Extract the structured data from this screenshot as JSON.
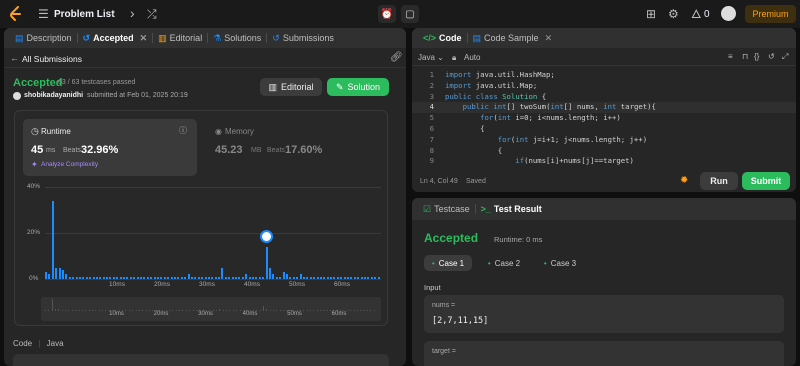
{
  "topbar": {
    "title": "Problem List",
    "streak": "0",
    "premium": "Premium"
  },
  "left": {
    "tabs": [
      {
        "label": "Description"
      },
      {
        "label": "Accepted"
      },
      {
        "label": "Editorial"
      },
      {
        "label": "Solutions"
      },
      {
        "label": "Submissions"
      }
    ],
    "back": "All Submissions",
    "status": "Accepted",
    "testcases": "63 / 63 testcases passed",
    "user": "shobikadayanidhi",
    "submitted": "submitted at Feb 01, 2025 20:19",
    "editorial_btn": "Editorial",
    "solution_btn": "Solution",
    "runtime": {
      "title": "Runtime",
      "value": "45",
      "unit": "ms",
      "beats_label": "Beats",
      "beats": "32.96%",
      "analyze": "Analyze Complexity"
    },
    "memory": {
      "title": "Memory",
      "value": "45.23",
      "unit": "MB",
      "beats_label": "Beats",
      "beats": "17.60%"
    },
    "chart": {
      "yticks": [
        "40%",
        "20%",
        "0%"
      ],
      "xticks": [
        "10ms",
        "20ms",
        "30ms",
        "40ms",
        "50ms",
        "60ms"
      ],
      "mini_ticks": [
        "10ms",
        "20ms",
        "30ms",
        "40ms",
        "50ms",
        "60ms"
      ],
      "values": [
        3,
        2,
        34,
        5,
        5,
        4,
        2,
        1,
        1,
        1,
        1,
        1,
        1,
        1,
        1,
        1,
        1,
        1,
        1,
        1,
        1,
        1,
        1,
        1,
        1,
        1,
        1,
        1,
        1,
        1,
        1,
        1,
        1,
        1,
        1,
        1,
        1,
        1,
        1,
        1,
        1,
        1,
        2,
        1,
        1,
        1,
        1,
        1,
        1,
        1,
        1,
        1,
        5,
        1,
        1,
        1,
        1,
        1,
        1,
        2,
        1,
        1,
        1,
        1,
        1,
        14,
        5,
        2,
        1,
        1,
        3,
        2,
        1,
        1,
        1,
        2,
        1,
        1,
        1,
        1,
        1,
        1,
        1,
        1,
        1,
        1,
        1,
        1,
        1,
        1,
        1,
        1,
        1,
        1,
        1,
        1,
        1,
        1,
        1
      ],
      "ymax": 40,
      "highlight_index": 65,
      "colors": {
        "bar": "#1a8cff",
        "grid": "#3a3a3a"
      }
    },
    "code_header": {
      "label": "Code",
      "lang": "Java"
    }
  },
  "editor": {
    "tabs": [
      {
        "label": "Code"
      },
      {
        "label": "Code Sample"
      }
    ],
    "lang": "Java",
    "mode": "Auto",
    "lines": [
      {
        "n": "1",
        "t": "import java.util.HashMap;"
      },
      {
        "n": "2",
        "t": "import java.util.Map;"
      },
      {
        "n": "3",
        "t": "public class Solution {"
      },
      {
        "n": "4",
        "t": "    public int[] twoSum(int[] nums, int target){"
      },
      {
        "n": "5",
        "t": "        for(int i=0; i<nums.length; i++)"
      },
      {
        "n": "6",
        "t": "        {"
      },
      {
        "n": "7",
        "t": "            for(int j=i+1; j<nums.length; j++)"
      },
      {
        "n": "8",
        "t": "            {"
      },
      {
        "n": "9",
        "t": "                if(nums[i]+nums[j]==target)"
      }
    ],
    "status": "Ln 4, Col 49",
    "saved": "Saved",
    "run": "Run",
    "submit": "Submit"
  },
  "result": {
    "tabs": [
      {
        "label": "Testcase"
      },
      {
        "label": "Test Result"
      }
    ],
    "status": "Accepted",
    "runtime": "Runtime: 0 ms",
    "cases": [
      "Case 1",
      "Case 2",
      "Case 3"
    ],
    "input_label": "Input",
    "nums_label": "nums =",
    "nums_value": "[2,7,11,15]",
    "target_label": "target ="
  },
  "colors": {
    "accent_green": "#2cbb5d",
    "brand_orange": "#ffa116",
    "blue": "#1a8cff"
  }
}
